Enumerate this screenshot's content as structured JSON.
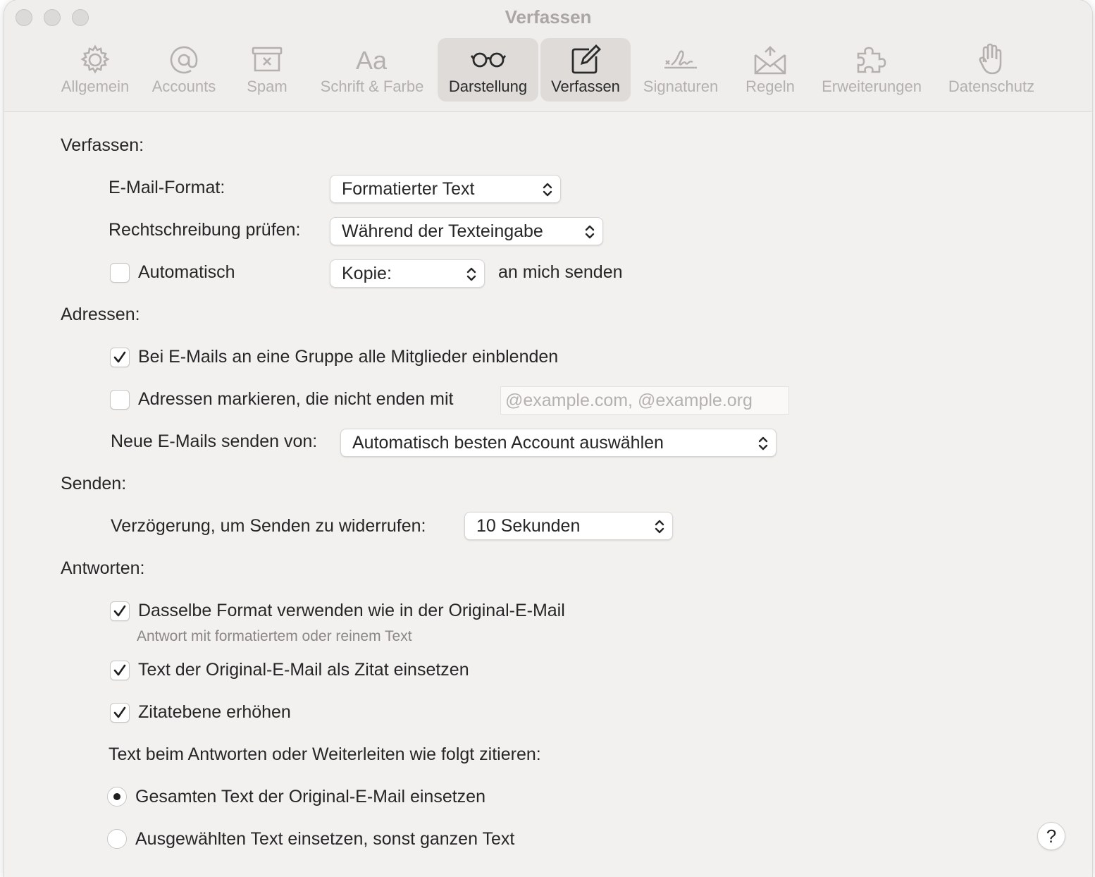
{
  "window": {
    "title": "Verfassen"
  },
  "toolbar": {
    "tabs": [
      {
        "label": "Allgemein",
        "icon": "gear-icon",
        "active": false
      },
      {
        "label": "Accounts",
        "icon": "at-sign-icon",
        "active": false
      },
      {
        "label": "Spam",
        "icon": "junk-tray-icon",
        "active": false
      },
      {
        "label": "Schrift & Farbe",
        "icon": "font-aa-icon",
        "active": false
      },
      {
        "label": "Darstellung",
        "icon": "glasses-icon",
        "active": true
      },
      {
        "label": "Verfassen",
        "icon": "compose-pencil-icon",
        "active": true
      },
      {
        "label": "Signaturen",
        "icon": "signature-icon",
        "active": false
      },
      {
        "label": "Regeln",
        "icon": "envelope-rules-icon",
        "active": false
      },
      {
        "label": "Erweiterungen",
        "icon": "puzzle-icon",
        "active": false
      },
      {
        "label": "Datenschutz",
        "icon": "hand-icon",
        "active": false
      }
    ]
  },
  "compose": {
    "section_label": "Verfassen:",
    "format_label": "E-Mail-Format:",
    "format_value": "Formatierter Text",
    "spelling_label": "Rechtschreibung prüfen:",
    "spelling_value": "Während der Texteingabe",
    "auto_label": "Automatisch",
    "auto_checked": false,
    "copy_value": "Kopie:",
    "copy_suffix": "an mich senden"
  },
  "addresses": {
    "section_label": "Adressen:",
    "group_label": "Bei E-Mails an eine Gruppe alle Mitglieder einblenden",
    "group_checked": true,
    "mark_label": "Adressen markieren, die nicht enden mit",
    "mark_checked": false,
    "mark_placeholder": "@example.com, @example.org",
    "send_from_label": "Neue E-Mails senden von:",
    "send_from_value": "Automatisch besten Account auswählen"
  },
  "sending": {
    "section_label": "Senden:",
    "undo_delay_label": "Verzögerung, um Senden zu widerrufen:",
    "undo_delay_value": "10 Sekunden"
  },
  "replies": {
    "section_label": "Antworten:",
    "same_format_label": "Dasselbe Format verwenden wie in der Original-E-Mail",
    "same_format_checked": true,
    "same_format_hint": "Antwort mit formatiertem oder reinem Text",
    "quote_label": "Text der Original-E-Mail als Zitat einsetzen",
    "quote_checked": true,
    "increase_level_label": "Zitatebene erhöhen",
    "increase_level_checked": true,
    "quote_mode_heading": "Text beim Antworten oder Weiterleiten wie folgt zitieren:",
    "quote_all_label": "Gesamten Text der Original-E-Mail einsetzen",
    "quote_all_selected": true,
    "quote_selected_label": "Ausgewählten Text einsetzen, sonst ganzen Text",
    "quote_selected_selected": false
  },
  "help": {
    "label": "?"
  }
}
